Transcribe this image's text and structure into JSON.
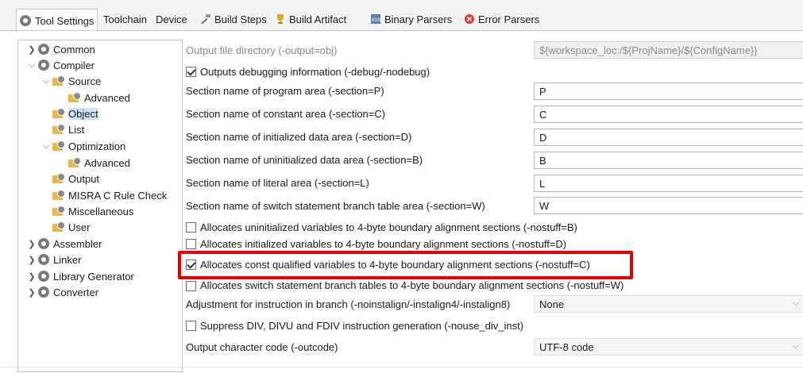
{
  "tabs": [
    {
      "label": "Tool Settings",
      "icon": "gear-icon",
      "active": true
    },
    {
      "label": "Toolchain",
      "icon": null,
      "active": false
    },
    {
      "label": "Device",
      "icon": null,
      "active": false
    },
    {
      "label": "Build Steps",
      "icon": "hammer-icon",
      "active": false
    },
    {
      "label": "Build Artifact",
      "icon": "trophy-icon",
      "active": false
    },
    {
      "label": "Binary Parsers",
      "icon": "binary-icon",
      "active": false
    },
    {
      "label": "Error Parsers",
      "icon": "error-icon",
      "active": false
    }
  ],
  "tree": {
    "common": "Common",
    "compiler": "Compiler",
    "source": "Source",
    "source_advanced": "Advanced",
    "object": "Object",
    "list": "List",
    "optimization": "Optimization",
    "optimization_advanced": "Advanced",
    "output": "Output",
    "misra": "MISRA C Rule Check",
    "misc": "Miscellaneous",
    "user": "User",
    "assembler": "Assembler",
    "linker": "Linker",
    "library_generator": "Library Generator",
    "converter": "Converter"
  },
  "settings": {
    "output_dir_label": "Output file directory (-output=obj)",
    "output_dir_value": "${workspace_loc:/${ProjName}/${ConfigName}}",
    "debug_label": "Outputs debugging information (-debug/-nodebug)",
    "program_label": "Section name of program area (-section=P)",
    "program_value": "P",
    "constant_label": "Section name of constant area (-section=C)",
    "constant_value": "C",
    "init_label": "Section name of initialized data area (-section=D)",
    "init_value": "D",
    "uninit_label": "Section name of uninitialized data area (-section=B)",
    "uninit_value": "B",
    "literal_label": "Section name of literal area (-section=L)",
    "literal_value": "L",
    "switch_label": "Section name of switch statement branch table area (-section=W)",
    "switch_value": "W",
    "nostuff_b_label": "Allocates uninitialized variables to 4-byte boundary alignment sections (-nostuff=B)",
    "nostuff_d_label": "Allocates initialized variables to 4-byte boundary alignment sections (-nostuff=D)",
    "nostuff_c_label": "Allocates const qualified variables to 4-byte boundary alignment sections (-nostuff=C)",
    "nostuff_w_label": "Allocates switch statement branch tables to 4-byte boundary alignment sections (-nostuff=W)",
    "instalign_label": "Adjustment for instruction in branch (-noinstalign/-instalign4/-instalign8)",
    "instalign_value": "None",
    "nouse_div_label": "Suppress DIV, DIVU and FDIV instruction generation (-nouse_div_inst)",
    "outcode_label": "Output character code (-outcode)",
    "outcode_value": "UTF-8 code"
  },
  "colors": {
    "highlight": "#e30000",
    "selection": "#cce4f7"
  }
}
